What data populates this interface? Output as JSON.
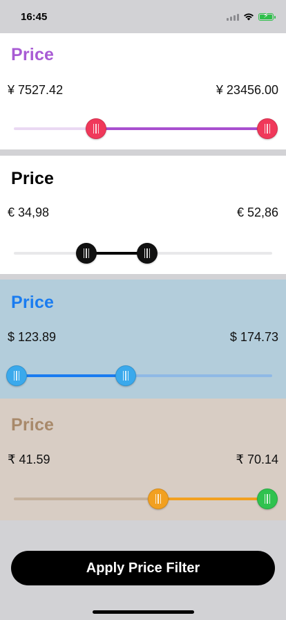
{
  "status_bar": {
    "time": "16:45"
  },
  "panels": [
    {
      "title": "Price",
      "min_label": "¥ 7527.42",
      "max_label": "¥ 23456.00",
      "title_color": "#a85bd4",
      "bg": "#ffffff",
      "accent": "#a84fcf",
      "track": "#ead9f3",
      "thumb_colors": [
        "#f0385a",
        "#f0385a"
      ]
    },
    {
      "title": "Price",
      "min_label": "€ 34,98",
      "max_label": "€ 52,86",
      "title_color": "#000000",
      "bg": "#ffffff",
      "accent": "#000000",
      "track": "#e8e8ea",
      "thumb_colors": [
        "#111111",
        "#111111"
      ]
    },
    {
      "title": "Price",
      "min_label": "$ 123.89",
      "max_label": "$ 174.73",
      "title_color": "#1a7cf0",
      "bg": "#b3cddb",
      "accent": "#1a7cf0",
      "track": "#8fb9e6",
      "thumb_colors": [
        "#3aa9ec",
        "#3aa9ec"
      ]
    },
    {
      "title": "Price",
      "min_label": "₹ 41.59",
      "max_label": "₹ 70.14",
      "title_color": "#a8896a",
      "bg": "#d8cdc4",
      "accent": "#f2a020",
      "track": "#c4b09c",
      "thumb_colors": [
        "#f2a020",
        "#2fc24f"
      ]
    }
  ],
  "apply_button": {
    "label": "Apply Price Filter"
  }
}
